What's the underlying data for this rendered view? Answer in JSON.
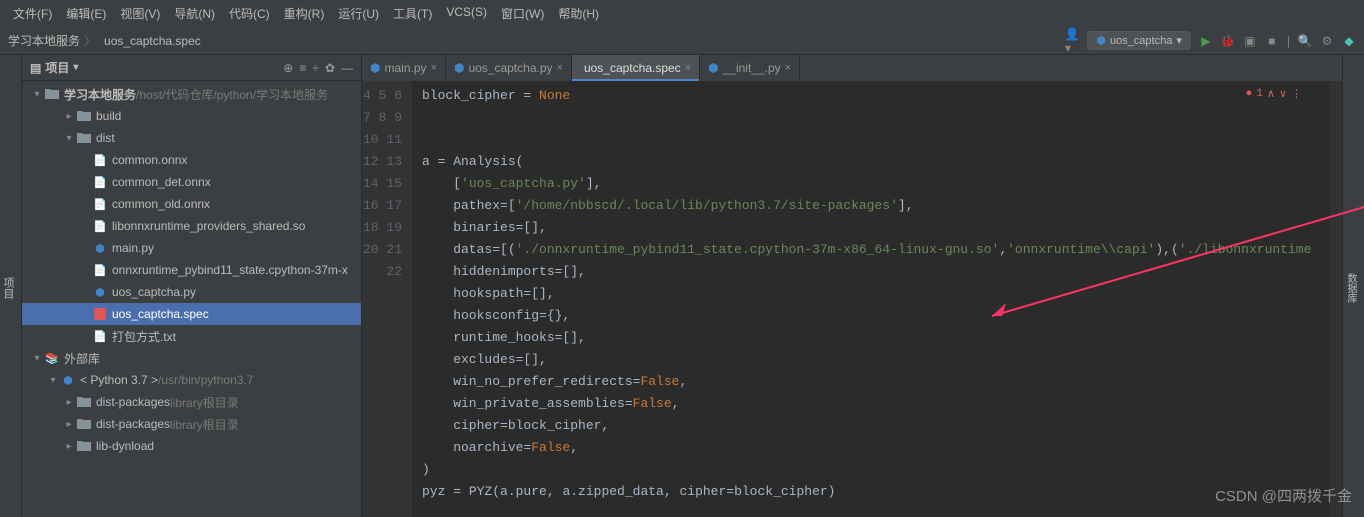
{
  "menu": [
    "文件(F)",
    "编辑(E)",
    "视图(V)",
    "导航(N)",
    "代码(C)",
    "重构(R)",
    "运行(U)",
    "工具(T)",
    "VCS(S)",
    "窗口(W)",
    "帮助(H)"
  ],
  "breadcrumb": {
    "root": "学习本地服务",
    "file": "uos_captcha.spec"
  },
  "run_config": "uos_captcha",
  "sidebar_title": "项目",
  "side_tab_left": "项目",
  "side_tab_right": "数据库",
  "tree": {
    "root": {
      "name": "学习本地服务",
      "path": "/host/代码仓库/python/学习本地服务"
    },
    "items": [
      {
        "name": "build",
        "type": "folder",
        "expand": "closed",
        "depth": 2
      },
      {
        "name": "dist",
        "type": "folder",
        "expand": "open",
        "depth": 2
      },
      {
        "name": "common.onnx",
        "type": "file",
        "depth": 3
      },
      {
        "name": "common_det.onnx",
        "type": "file",
        "depth": 3
      },
      {
        "name": "common_old.onnx",
        "type": "file",
        "depth": 3
      },
      {
        "name": "libonnxruntime_providers_shared.so",
        "type": "file",
        "depth": 3
      },
      {
        "name": "main.py",
        "type": "py",
        "depth": 3
      },
      {
        "name": "onnxruntime_pybind11_state.cpython-37m-x",
        "type": "file",
        "depth": 3
      },
      {
        "name": "uos_captcha.py",
        "type": "py",
        "depth": 3
      },
      {
        "name": "uos_captcha.spec",
        "type": "spec",
        "depth": 3,
        "selected": true
      },
      {
        "name": "打包方式.txt",
        "type": "txt",
        "depth": 3
      }
    ],
    "ext_lib": "外部库",
    "python": {
      "name": "< Python 3.7 >",
      "path": "/usr/bin/python3.7"
    },
    "sub": [
      {
        "name": "dist-packages",
        "note": "library根目录"
      },
      {
        "name": "dist-packages",
        "note": "library根目录"
      },
      {
        "name": "lib-dynload",
        "note": ""
      }
    ]
  },
  "tabs": [
    {
      "label": "main.py",
      "icon": "py"
    },
    {
      "label": "uos_captcha.py",
      "icon": "py"
    },
    {
      "label": "uos_captcha.spec",
      "icon": "spec",
      "active": true
    },
    {
      "label": "__init__.py",
      "icon": "py"
    }
  ],
  "error_count": "1",
  "lines": {
    "start": 4,
    "rows": [
      {
        "n": 4,
        "seg": [
          [
            "",
            "block_cipher "
          ],
          [
            "op",
            "= "
          ],
          [
            "kw",
            "None"
          ]
        ]
      },
      {
        "n": 5,
        "seg": [
          [
            "",
            ""
          ]
        ]
      },
      {
        "n": 6,
        "seg": [
          [
            "",
            ""
          ]
        ]
      },
      {
        "n": 7,
        "seg": [
          [
            "",
            "a "
          ],
          [
            "op",
            "= "
          ],
          [
            "",
            "Analysis("
          ]
        ]
      },
      {
        "n": 8,
        "seg": [
          [
            "",
            "    ["
          ],
          [
            "str",
            "'uos_captcha.py'"
          ],
          [
            "",
            "],"
          ]
        ]
      },
      {
        "n": 9,
        "seg": [
          [
            "",
            "    pathex=["
          ],
          [
            "str",
            "'/home/nbbscd/.local/lib/python3.7/site-packages'"
          ],
          [
            "",
            "],"
          ]
        ]
      },
      {
        "n": 10,
        "seg": [
          [
            "",
            "    binaries=[],"
          ]
        ]
      },
      {
        "n": 11,
        "seg": [
          [
            "",
            "    datas=[("
          ],
          [
            "str",
            "'./onnxruntime_pybind11_state.cpython-37m-x86_64-linux-gnu.so'"
          ],
          [
            "",
            ","
          ],
          [
            "str",
            "'onnxruntime\\\\capi'"
          ],
          [
            "",
            "),("
          ],
          [
            "str",
            "'./libonnxruntime"
          ]
        ]
      },
      {
        "n": 12,
        "seg": [
          [
            "",
            "    hiddenimports=[],"
          ]
        ]
      },
      {
        "n": 13,
        "seg": [
          [
            "",
            "    hookspath=[],"
          ]
        ]
      },
      {
        "n": 14,
        "seg": [
          [
            "",
            "    hooksconfig={},"
          ]
        ]
      },
      {
        "n": 15,
        "seg": [
          [
            "",
            "    runtime_hooks=[],"
          ]
        ]
      },
      {
        "n": 16,
        "seg": [
          [
            "",
            "    excludes=[],"
          ]
        ]
      },
      {
        "n": 17,
        "seg": [
          [
            "",
            "    win_no_prefer_redirects="
          ],
          [
            "kw",
            "False"
          ],
          [
            "",
            ","
          ]
        ]
      },
      {
        "n": 18,
        "seg": [
          [
            "",
            "    win_private_assemblies="
          ],
          [
            "kw",
            "False"
          ],
          [
            "",
            ","
          ]
        ]
      },
      {
        "n": 19,
        "seg": [
          [
            "",
            "    cipher=block_cipher,"
          ]
        ]
      },
      {
        "n": 20,
        "seg": [
          [
            "",
            "    noarchive="
          ],
          [
            "kw",
            "False"
          ],
          [
            "",
            ","
          ]
        ]
      },
      {
        "n": 21,
        "seg": [
          [
            "",
            ")"
          ]
        ]
      },
      {
        "n": 22,
        "seg": [
          [
            "",
            "pyz "
          ],
          [
            "op",
            "= "
          ],
          [
            "",
            "PYZ(a.pure, a.zipped_data, cipher=block_cipher)"
          ]
        ]
      }
    ]
  },
  "watermark": "CSDN @四两拨千金"
}
